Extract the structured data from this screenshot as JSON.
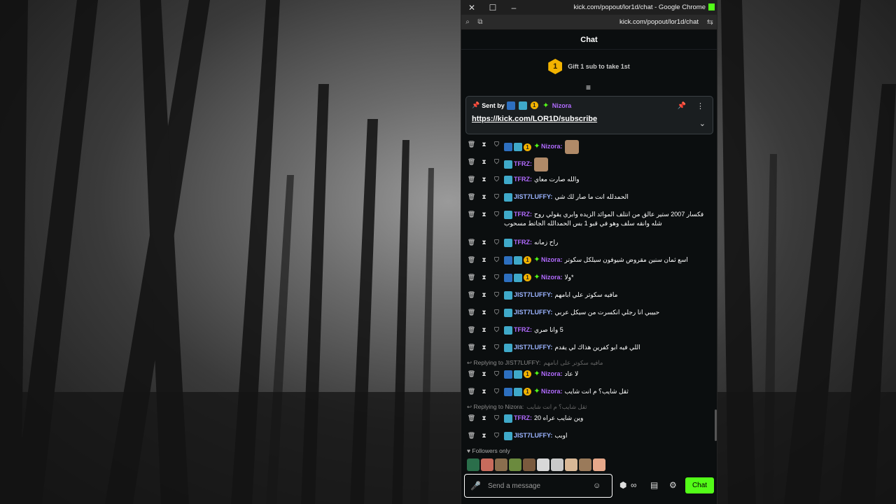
{
  "window": {
    "title": "kick.com/popout/lor1d/chat - Google Chrome",
    "url": "kick.com/popout/lor1d/chat"
  },
  "chat": {
    "header": "Chat",
    "gift_rank": "1",
    "gift_text": "Gift 1 sub to take 1st",
    "pinned": {
      "sent_by": "Sent by",
      "sub_badge": "1",
      "username": "Nizora",
      "link": "https://kick.com/LOR1D/subscribe"
    },
    "partial_top": "TFRZ: ...",
    "messages": [
      {
        "user": "Nizora:",
        "color": "u-purple",
        "badges": [
          "pick",
          "og",
          "sub",
          "star"
        ],
        "text": "",
        "emote": true
      },
      {
        "user": "TFRZ:",
        "color": "u-purple",
        "badges": [
          "og"
        ],
        "text": "",
        "emote": true
      },
      {
        "user": "TFRZ:",
        "color": "u-purple",
        "badges": [
          "og"
        ],
        "text": "والله صارت معاي"
      },
      {
        "user": "JIST7LUFFY:",
        "color": "u-light",
        "badges": [
          "og"
        ],
        "text": "الحمدلله انت ما صار لك شي"
      },
      {
        "user": "TFRZ:",
        "color": "u-purple",
        "badges": [
          "og"
        ],
        "text": "فكسار 2007 ستير عالق من انتلف الموائد الزيده وابري يقولي روح شله وانقه سلف وهو في قبو 1 بس الحمدالله الجاتط مسحوب",
        "tall": true
      },
      {
        "user": "TFRZ:",
        "color": "u-purple",
        "badges": [
          "og"
        ],
        "text": "راح زمانه"
      },
      {
        "user": "Nizora:",
        "color": "u-purple",
        "badges": [
          "pick",
          "og",
          "sub",
          "star"
        ],
        "text": "اسع ثمان سنين مقروض شيوفون سيلكل سكوتر"
      },
      {
        "user": "Nizora:",
        "color": "u-purple",
        "badges": [
          "pick",
          "og",
          "sub",
          "star"
        ],
        "text": "*ولا"
      },
      {
        "user": "JIST7LUFFY:",
        "color": "u-light",
        "badges": [
          "og"
        ],
        "text": "مافيه سكوتر علي ابامهم"
      },
      {
        "user": "JIST7LUFFY:",
        "color": "u-light",
        "badges": [
          "og"
        ],
        "text": "حبيبي انا رجلي انكسرت من سيكل عربي"
      },
      {
        "user": "TFRZ:",
        "color": "u-purple",
        "badges": [
          "og"
        ],
        "text": "5 وانا صري"
      },
      {
        "user": "JIST7LUFFY:",
        "color": "u-light",
        "badges": [
          "og"
        ],
        "text": "اللي فيه ابو كفرين هذاك لي يقدم"
      },
      {
        "reply": "Replying to JIST7LUFFY:",
        "reply_text": "مافيه سكوتر على ابامهم"
      },
      {
        "user": "Nizora:",
        "color": "u-purple",
        "badges": [
          "pick",
          "og",
          "sub",
          "star"
        ],
        "text": "لا عاد"
      },
      {
        "user": "Nizora:",
        "color": "u-purple",
        "badges": [
          "pick",
          "og",
          "sub",
          "star"
        ],
        "text": "ثقل شايب؟ م انت شايب"
      },
      {
        "reply": "Replying to Nizora:",
        "reply_text": "ثقل شايب؟ م انت شايب"
      },
      {
        "user": "TFRZ:",
        "color": "u-purple",
        "badges": [
          "og"
        ],
        "text": "وين شايب عراه 20"
      },
      {
        "user": "JIST7LUFFY:",
        "color": "u-light",
        "badges": [
          "og"
        ],
        "text": "اوبب"
      }
    ],
    "followers_only": "Followers only",
    "input_placeholder": "Send a message",
    "send_label": "Chat"
  },
  "colors": {
    "accent": "#53fc18",
    "username_purple": "#b26bff",
    "gift": "#f2b300"
  },
  "icons": [
    "close-icon",
    "maximize-icon",
    "minimize-icon",
    "search-icon",
    "pin-icon",
    "more-icon",
    "chevron-down-icon",
    "trash-icon",
    "timeout-icon",
    "shield-icon",
    "mic-icon",
    "smile-icon",
    "settings-icon",
    "store-icon"
  ]
}
